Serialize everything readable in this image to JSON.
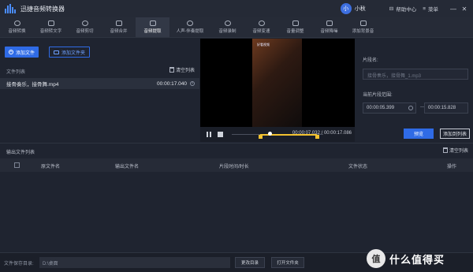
{
  "app": {
    "title": "迅捷音频转换器"
  },
  "user": {
    "avatar_letter": "小",
    "name": "小秋"
  },
  "window": {
    "help_label": "帮助中心",
    "menu_label": "菜单"
  },
  "toolbar": {
    "items": [
      {
        "label": "音频转换",
        "icon": "convert-icon"
      },
      {
        "label": "音频转文字",
        "icon": "text-icon"
      },
      {
        "label": "音频剪切",
        "icon": "scissors-icon"
      },
      {
        "label": "音频合并",
        "icon": "merge-icon"
      },
      {
        "label": "音频提取",
        "icon": "extract-icon",
        "active": true
      },
      {
        "label": "人声-伴奏提取",
        "icon": "vocal-icon"
      },
      {
        "label": "音频录制",
        "icon": "record-icon"
      },
      {
        "label": "音频变速",
        "icon": "speed-icon"
      },
      {
        "label": "音量调整",
        "icon": "volume-icon"
      },
      {
        "label": "音频降噪",
        "icon": "denoise-icon"
      },
      {
        "label": "添加背景音",
        "icon": "bgm-icon"
      }
    ]
  },
  "left": {
    "add_file": "添加文件",
    "add_folder": "添加文件夹",
    "list_header": "文件列表",
    "clear_list": "清空列表",
    "files": [
      {
        "name": "接骨奏乐，接骨舞.mp4",
        "duration": "00:00:17.040"
      }
    ]
  },
  "video": {
    "watermark": "好看视频"
  },
  "player": {
    "current": "00:00:07.032",
    "separator": "/",
    "total": "00:00:17.086",
    "head_fraction": 0.41,
    "sel_start_fraction": 0.31,
    "sel_end_fraction": 0.93
  },
  "right": {
    "name_label": "片段名:",
    "name_placeholder": "接骨奏乐，接骨舞_1.mp3",
    "range_label": "当前片段范围:",
    "start_time": "00:00:05.399",
    "dash": "—",
    "end_time": "00:00:15.828",
    "preview": "预览",
    "add_to_list": "添加到列表"
  },
  "output": {
    "title": "输出文件列表",
    "clear": "清空列表",
    "columns": [
      "原文件名",
      "输出文件名",
      "片段时间/时长",
      "文件状态",
      "操作"
    ]
  },
  "bottom": {
    "save_label": "文件保存目录:",
    "save_path": "D:\\桌面",
    "change_dir": "更改目录",
    "open_folder": "打开文件夹"
  },
  "site_watermark": {
    "logo": "值",
    "text": "什么值得买"
  }
}
